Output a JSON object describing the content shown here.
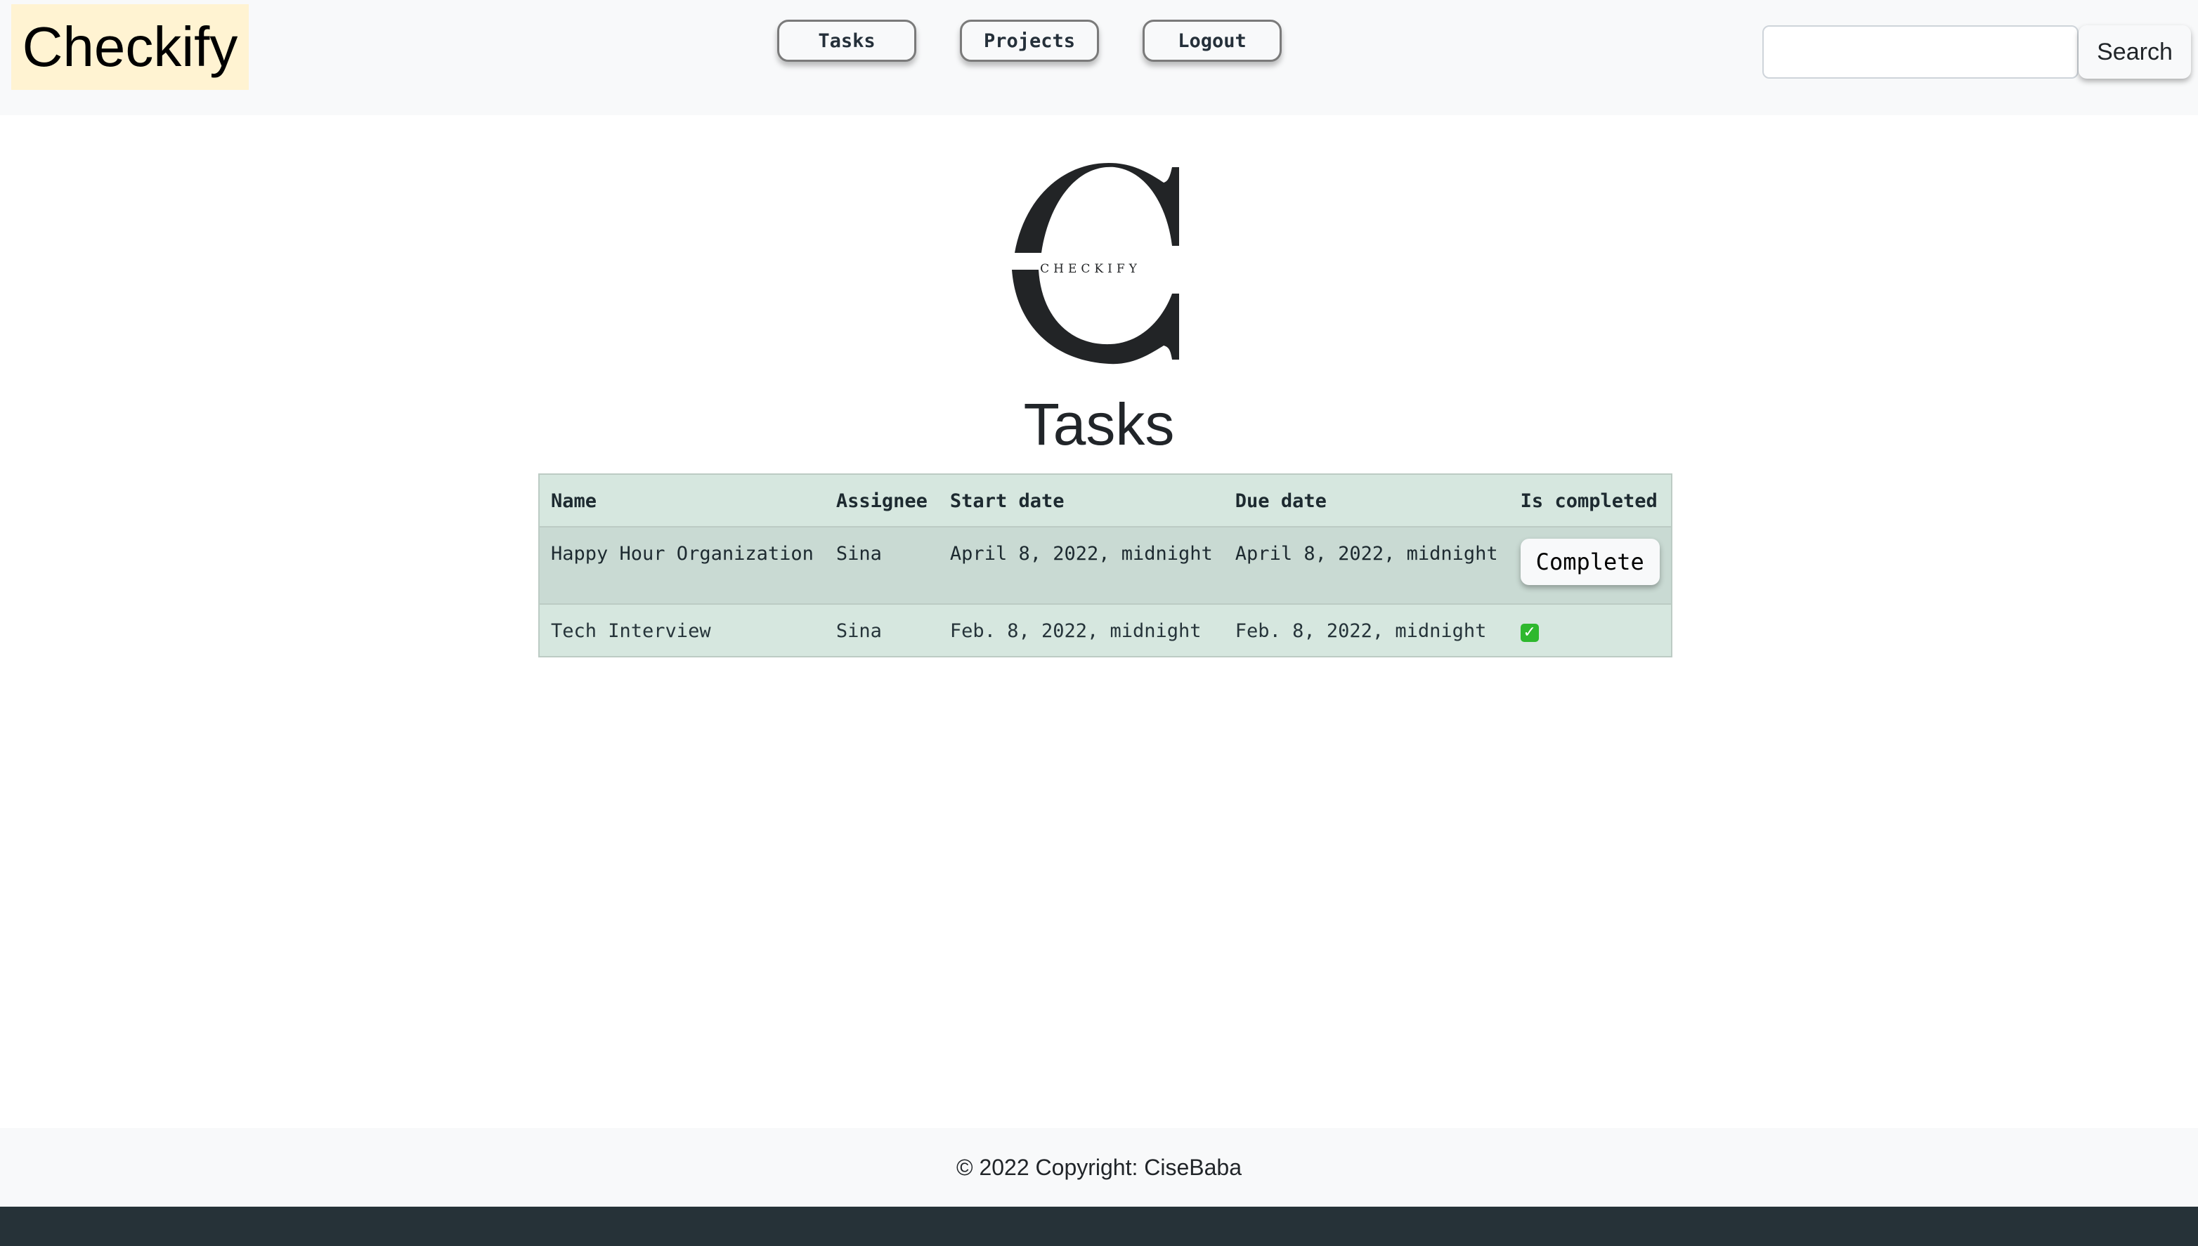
{
  "navbar": {
    "brand": "Checkify",
    "links": [
      {
        "label": "Tasks"
      },
      {
        "label": "Projects"
      },
      {
        "label": "Logout"
      }
    ],
    "search": {
      "value": "",
      "placeholder": "",
      "button_label": "Search"
    }
  },
  "logo": {
    "letter": "C",
    "wordmark": "CHECKIFY"
  },
  "page": {
    "title": "Tasks"
  },
  "table": {
    "headers": [
      "Name",
      "Assignee",
      "Start date",
      "Due date",
      "Is completed"
    ],
    "rows": [
      {
        "name": "Happy Hour Organization",
        "assignee": "Sina",
        "start_date": "April 8, 2022, midnight",
        "due_date": "April 8, 2022, midnight",
        "is_completed": false,
        "action_label": "Complete"
      },
      {
        "name": "Tech Interview",
        "assignee": "Sina",
        "start_date": "Feb. 8, 2022, midnight",
        "due_date": "Feb. 8, 2022, midnight",
        "is_completed": true,
        "completed_icon": "✓"
      }
    ]
  },
  "footer": {
    "text": "© 2022 Copyright: CiseBaba"
  },
  "colors": {
    "navbar_bg": "#f8f9fa",
    "brand_bg": "#fff3d2",
    "table_bg": "#d6e7df",
    "table_highlight": "#c9dad3",
    "footer_dark": "#263238",
    "check_green": "#2eb82e"
  }
}
